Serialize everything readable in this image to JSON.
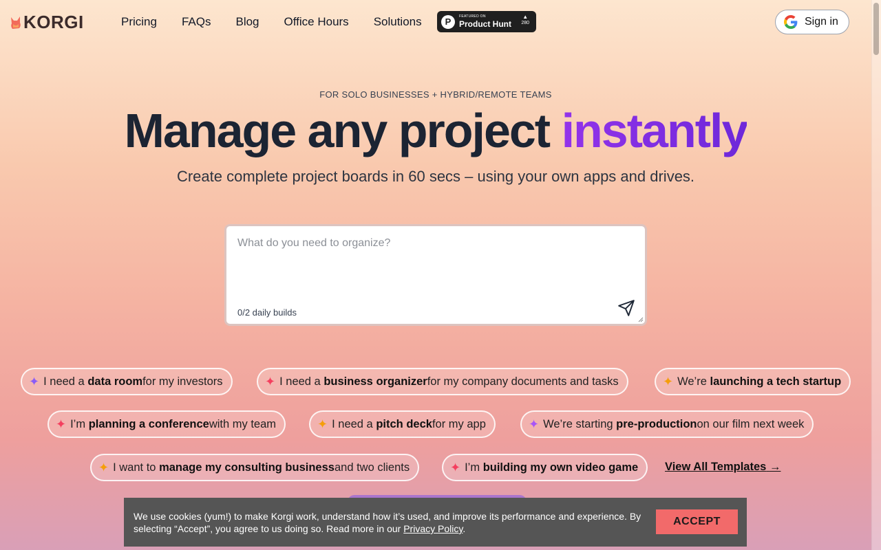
{
  "brand": {
    "name": "KORGI",
    "logo_icon": "corgi-icon"
  },
  "nav": {
    "items": [
      {
        "label": "Pricing"
      },
      {
        "label": "FAQs"
      },
      {
        "label": "Blog"
      },
      {
        "label": "Office Hours"
      },
      {
        "label": "Solutions"
      }
    ]
  },
  "product_hunt": {
    "small": "FEATURED ON",
    "big": "Product Hunt",
    "count": "280",
    "logo": "P"
  },
  "signin": {
    "label": "Sign in",
    "icon": "google-icon"
  },
  "hero": {
    "eyebrow": "FOR SOLO BUSINESSES + HYBRID/REMOTE TEAMS",
    "headline_main": "Manage any project ",
    "headline_accent": "instantly",
    "subhead": "Create complete project boards in 60 secs – using your own apps and drives."
  },
  "prompt": {
    "placeholder": "What do you need to organize?",
    "value": "",
    "builds": "0/2 daily builds",
    "send_icon": "send-icon"
  },
  "chips": [
    {
      "pre": "I need a ",
      "bold": "data room",
      "post": " for my investors",
      "spark_color": "#8b5cf6"
    },
    {
      "pre": "I need a ",
      "bold": "business organizer",
      "post": " for my company documents and tasks",
      "spark_color": "#f43f5e"
    },
    {
      "pre": "We’re ",
      "bold": "launching a tech startup",
      "post": "",
      "spark_color": "#f59e0b"
    },
    {
      "pre": "I’m ",
      "bold": "planning a conference",
      "post": " with my team",
      "spark_color": "#f43f5e"
    },
    {
      "pre": "I need a ",
      "bold": "pitch deck",
      "post": " for my app",
      "spark_color": "#f59e0b"
    },
    {
      "pre": "We’re starting ",
      "bold": "pre-production",
      "post": " on our film next week",
      "spark_color": "#a855f7"
    },
    {
      "pre": "I want to ",
      "bold": "manage my consulting business",
      "post": " and two clients",
      "spark_color": "#f59e0b"
    },
    {
      "pre": "I’m ",
      "bold": "building my own video game",
      "post": "",
      "spark_color": "#f43f5e"
    }
  ],
  "view_all": {
    "label": "View All Templates",
    "icon": "arrow-right-icon"
  },
  "cookie": {
    "text": "We use cookies (yum!) to make Korgi work, understand how it’s used, and improve its performance and experience. By selecting “Accept”, you agree to us doing so. Read more in our ",
    "link": "Privacy Policy",
    "after": ".",
    "accept": "ACCEPT"
  }
}
